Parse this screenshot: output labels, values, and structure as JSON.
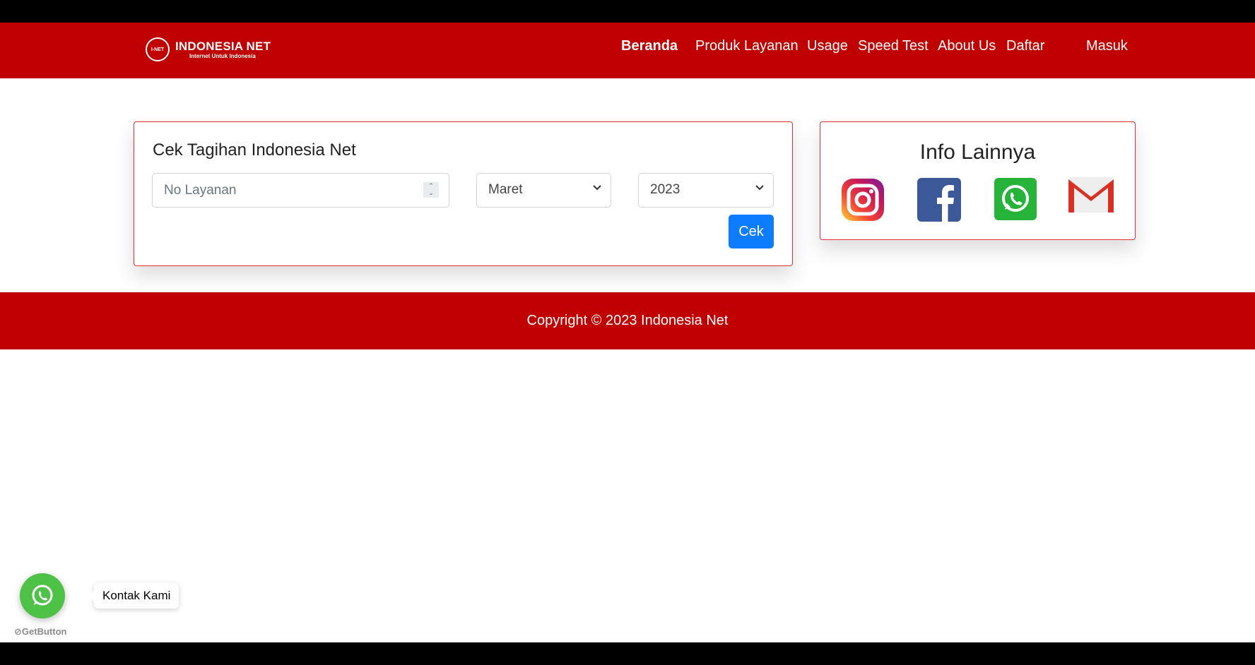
{
  "navbar": {
    "brand_logo_text": "I-NET",
    "brand_name": "INDONESIA NET",
    "brand_tagline": "Internet Untuk Indonesia",
    "links": [
      {
        "label": "Beranda"
      },
      {
        "label": "Produk Layanan"
      },
      {
        "label": "Usage"
      },
      {
        "label": "Speed Test"
      },
      {
        "label": "About Us"
      },
      {
        "label": "Daftar"
      },
      {
        "label": "Masuk"
      }
    ],
    "background": "#c00000"
  },
  "bill_card": {
    "title": "Cek Tagihan Indonesia Net",
    "service_input_placeholder": "No Layanan",
    "month_selected": "Maret",
    "year_selected": "2023",
    "submit_label": "Cek"
  },
  "info_card": {
    "title": "Info Lainnya",
    "icons": [
      "instagram-icon",
      "facebook-icon",
      "whatsapp-icon",
      "gmail-icon"
    ]
  },
  "footer": {
    "copyright": "Copyright © 2023 Indonesia Net"
  },
  "chat_widget": {
    "label": "Kontak Kami",
    "branding": "GetButton"
  },
  "colors": {
    "brand_red": "#c00000",
    "button_blue": "#0d7cff",
    "whatsapp_green": "#4dc247"
  }
}
